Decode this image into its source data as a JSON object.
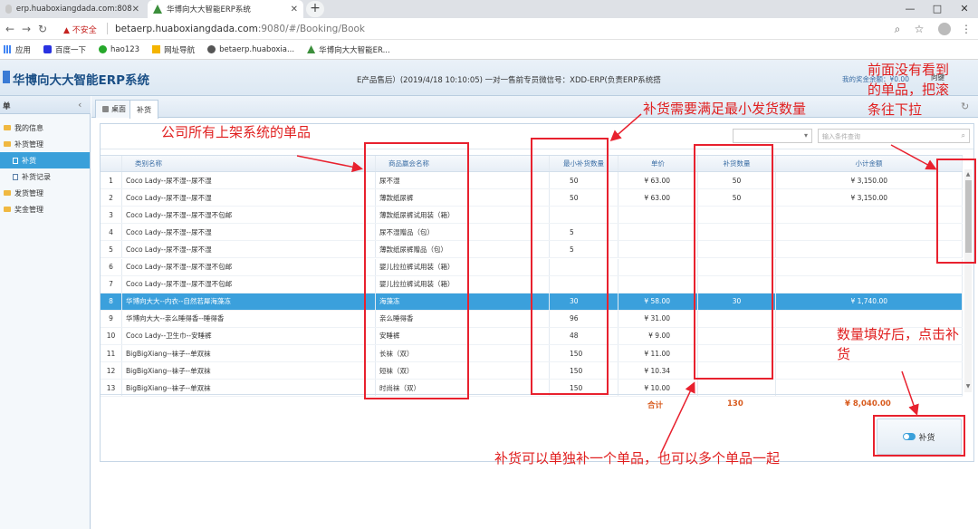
{
  "browser": {
    "tabs": [
      {
        "title": "erp.huaboxiangdada.com:808"
      },
      {
        "title": "华博向大大智能ERP系统"
      }
    ],
    "new_tab": "+",
    "window_controls": [
      "—",
      "□",
      "✕"
    ],
    "insecure_label": "不安全",
    "url_host": "betaerp.huaboxiangdada.com",
    "url_path": ":9080/#/Booking/Book",
    "bookmarks": [
      {
        "label": "应用",
        "icon": "apps-icon"
      },
      {
        "label": "百度一下",
        "icon": "baidu-icon"
      },
      {
        "label": "hao123",
        "icon": "hao123-icon"
      },
      {
        "label": "网址导航",
        "icon": "nav-icon"
      },
      {
        "label": "betaerp.huaboxia...",
        "icon": "huabo-icon"
      },
      {
        "label": "华博向大大智能ER...",
        "icon": "huabo-icon"
      }
    ]
  },
  "app": {
    "title": "华博向大大智能ERP系统",
    "marquee": "E产品售后）(2019/4/18 10:10:05) 一对一售前专员微信号：XDD-ERP(负责ERP系统搭",
    "account": "我的奖金余额：¥0.00",
    "user": "向键"
  },
  "sidebar": {
    "header": "单",
    "collapse": "‹",
    "items": [
      {
        "label": "我的信息",
        "type": "folder"
      },
      {
        "label": "补货管理",
        "type": "folder"
      },
      {
        "label": "补货",
        "type": "doc",
        "selected": true
      },
      {
        "label": "补货记录",
        "type": "doc"
      },
      {
        "label": "发货管理",
        "type": "folder"
      },
      {
        "label": "奖金管理",
        "type": "folder"
      }
    ]
  },
  "main_tabs": [
    {
      "label": "桌面"
    },
    {
      "label": "补货"
    }
  ],
  "refresh": "↻",
  "toolbar": {
    "select_arrow": "▾",
    "search_placeholder": "输入条件查询",
    "search_icon": "⌕"
  },
  "grid": {
    "headers": [
      "",
      "类别名称",
      "商品赢会名称",
      "最小补货数量",
      "单价",
      "补货数量",
      "小计金额"
    ],
    "rows": [
      {
        "no": "1",
        "category": "Coco Lady--尿不湿--尿不湿",
        "name": "尿不湿",
        "min": "50",
        "price": "¥ 63.00",
        "qty": "50",
        "subtotal": "¥ 3,150.00"
      },
      {
        "no": "2",
        "category": "Coco Lady--尿不湿--尿不湿",
        "name": "薄款纸尿裤",
        "min": "50",
        "price": "¥ 63.00",
        "qty": "50",
        "subtotal": "¥ 3,150.00"
      },
      {
        "no": "3",
        "category": "Coco Lady--尿不湿--尿不湿不包邮",
        "name": "薄款纸尿裤试用装（箱）",
        "min": "",
        "price": "",
        "qty": "",
        "subtotal": ""
      },
      {
        "no": "4",
        "category": "Coco Lady--尿不湿--尿不湿",
        "name": "尿不湿赠品（包）",
        "min": "5",
        "price": "",
        "qty": "",
        "subtotal": ""
      },
      {
        "no": "5",
        "category": "Coco Lady--尿不湿--尿不湿",
        "name": "薄款纸尿裤赠品（包）",
        "min": "5",
        "price": "",
        "qty": "",
        "subtotal": ""
      },
      {
        "no": "6",
        "category": "Coco Lady--尿不湿--尿不湿不包邮",
        "name": "婴儿拉拉裤试用装（箱）",
        "min": "",
        "price": "",
        "qty": "",
        "subtotal": ""
      },
      {
        "no": "7",
        "category": "Coco Lady--尿不湿--尿不湿不包邮",
        "name": "婴儿拉拉裤试用装（箱）",
        "min": "",
        "price": "",
        "qty": "",
        "subtotal": ""
      },
      {
        "no": "8",
        "category": "华博向大大--内衣--自然若犀海藻冻",
        "name": "海藻冻",
        "min": "30",
        "price": "¥ 58.00",
        "qty": "30",
        "subtotal": "¥ 1,740.00",
        "selected": true
      },
      {
        "no": "9",
        "category": "华博向大大--亲么睡得香--睡得香",
        "name": "亲么睡得香",
        "min": "96",
        "price": "¥ 31.00",
        "qty": "",
        "subtotal": ""
      },
      {
        "no": "10",
        "category": "Coco Lady--卫生巾--安睡裤",
        "name": "安睡裤",
        "min": "48",
        "price": "¥ 9.00",
        "qty": "",
        "subtotal": ""
      },
      {
        "no": "11",
        "category": "BigBigXiang--袜子--单双袜",
        "name": "长袜（双）",
        "min": "150",
        "price": "¥ 11.00",
        "qty": "",
        "subtotal": ""
      },
      {
        "no": "12",
        "category": "BigBigXiang--袜子--单双袜",
        "name": "短袜（双）",
        "min": "150",
        "price": "¥ 10.34",
        "qty": "",
        "subtotal": ""
      },
      {
        "no": "13",
        "category": "BigBigXiang--袜子--单双袜",
        "name": "时尚袜（双）",
        "min": "150",
        "price": "¥ 10.00",
        "qty": "",
        "subtotal": ""
      }
    ],
    "scroll_up": "▲",
    "scroll_down": "▼",
    "totals": {
      "label": "合计",
      "qty": "130",
      "amount": "¥ 8,040.00"
    }
  },
  "replenish_button": "补货",
  "annotations": {
    "all_items": "公司所有上架系统的单品",
    "min_qty": "补货需要满足最小发货数量",
    "scroll_hint": "前面没有看到的单品，把滚条往下拉",
    "click_hint": "数量填好后，点击补货",
    "single_multi": "补货可以单独补一个单品，也可以多个单品一起"
  },
  "colors": {
    "accent": "#3ba0dc",
    "annotation": "#e8212e",
    "total": "#d85b1e"
  }
}
